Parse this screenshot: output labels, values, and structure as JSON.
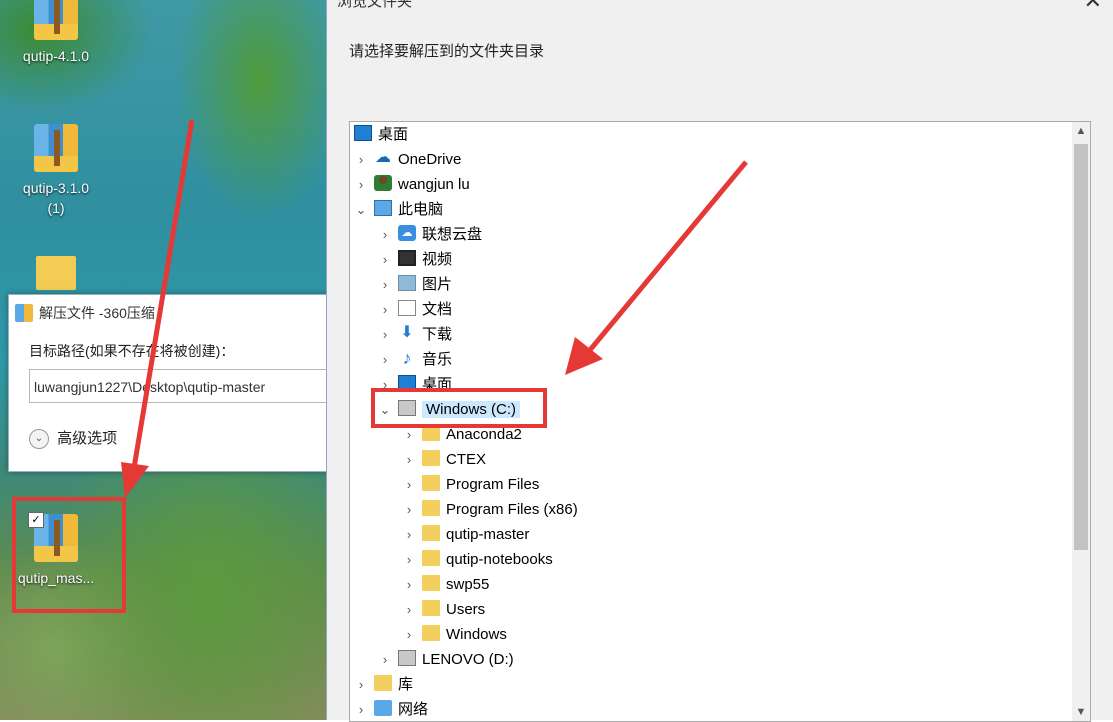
{
  "desktop": {
    "icons": [
      {
        "label": "qutip-4.1.0"
      },
      {
        "label": "qutip-3.1.0\n(1)"
      },
      {
        "label": "qutip_mas..."
      }
    ]
  },
  "small_dialog": {
    "title": "解压文件 -360压缩",
    "target_label": "目标路径(如果不存在将被创建)：",
    "path_value": "luwangjun1227\\Desktop\\qutip-master",
    "advanced_label": "高级选项"
  },
  "browse_dialog": {
    "title": "浏览文件夹",
    "prompt": "请选择要解压到的文件夹目录",
    "tree": [
      {
        "label": "桌面"
      },
      {
        "label": "OneDrive"
      },
      {
        "label": "wangjun lu"
      },
      {
        "label": "此电脑"
      },
      {
        "label": "联想云盘"
      },
      {
        "label": "视频"
      },
      {
        "label": "图片"
      },
      {
        "label": "文档"
      },
      {
        "label": "下载"
      },
      {
        "label": "音乐"
      },
      {
        "label": "桌面"
      },
      {
        "label": "Windows (C:)"
      },
      {
        "label": "Anaconda2"
      },
      {
        "label": "CTEX"
      },
      {
        "label": "Program Files"
      },
      {
        "label": "Program Files (x86)"
      },
      {
        "label": "qutip-master"
      },
      {
        "label": "qutip-notebooks"
      },
      {
        "label": "swp55"
      },
      {
        "label": "Users"
      },
      {
        "label": "Windows"
      },
      {
        "label": "LENOVO (D:)"
      },
      {
        "label": "库"
      },
      {
        "label": "网络"
      }
    ]
  },
  "colors": {
    "annotation_red": "#e53935",
    "selection": "#cce8ff"
  }
}
